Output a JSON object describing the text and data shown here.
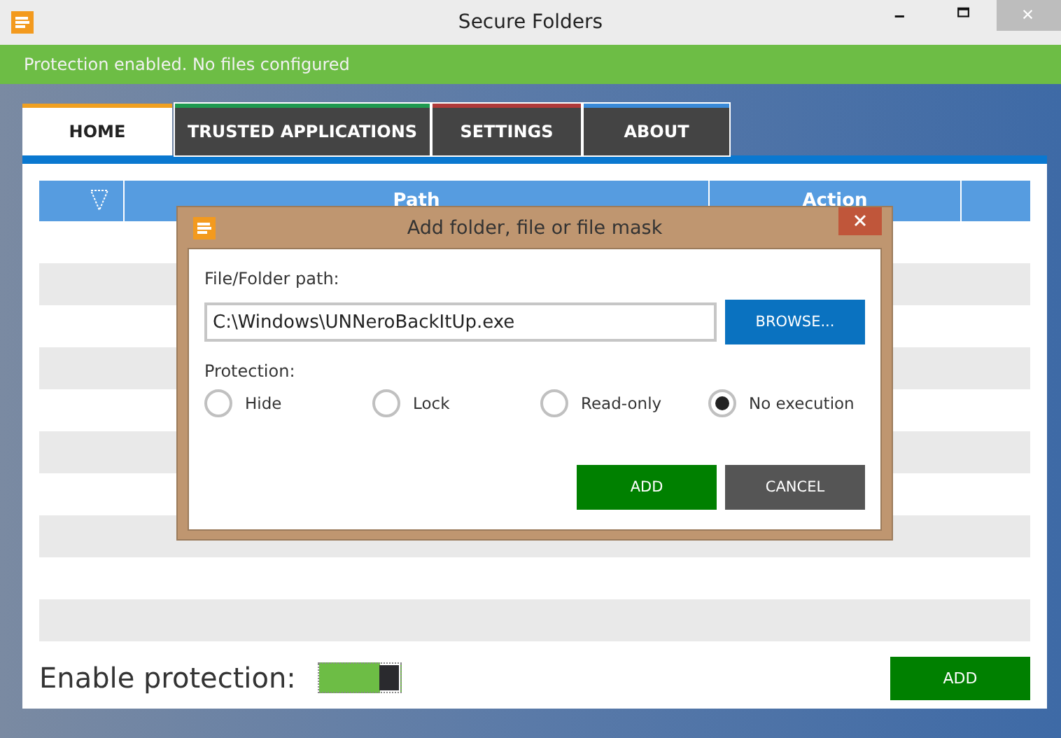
{
  "window": {
    "title": "Secure Folders"
  },
  "status_bar": {
    "text": "Protection enabled. No files configured"
  },
  "tabs": [
    {
      "label": "HOME",
      "selected": true,
      "color": "#f0a020"
    },
    {
      "label": "TRUSTED APPLICATIONS",
      "selected": false,
      "color": "#1e9a50"
    },
    {
      "label": "SETTINGS",
      "selected": false,
      "color": "#b03a3a"
    },
    {
      "label": "ABOUT",
      "selected": false,
      "color": "#3a8ad8"
    }
  ],
  "table": {
    "columns": [
      "Path",
      "Action"
    ]
  },
  "enable_protection": {
    "label": "Enable protection:",
    "on": true
  },
  "add_button": "ADD",
  "dialog": {
    "title": "Add folder, file or file mask",
    "path_label": "File/Folder path:",
    "path_value": "C:\\Windows\\UNNeroBackItUp.exe",
    "browse_button": "BROWSE...",
    "protection_label": "Protection:",
    "options": [
      {
        "label": "Hide",
        "selected": false
      },
      {
        "label": "Lock",
        "selected": false
      },
      {
        "label": "Read-only",
        "selected": false
      },
      {
        "label": "No execution",
        "selected": true
      }
    ],
    "buttons": [
      {
        "label": "ADD",
        "kind": "primary"
      },
      {
        "label": "CANCEL",
        "kind": "secondary"
      }
    ]
  }
}
